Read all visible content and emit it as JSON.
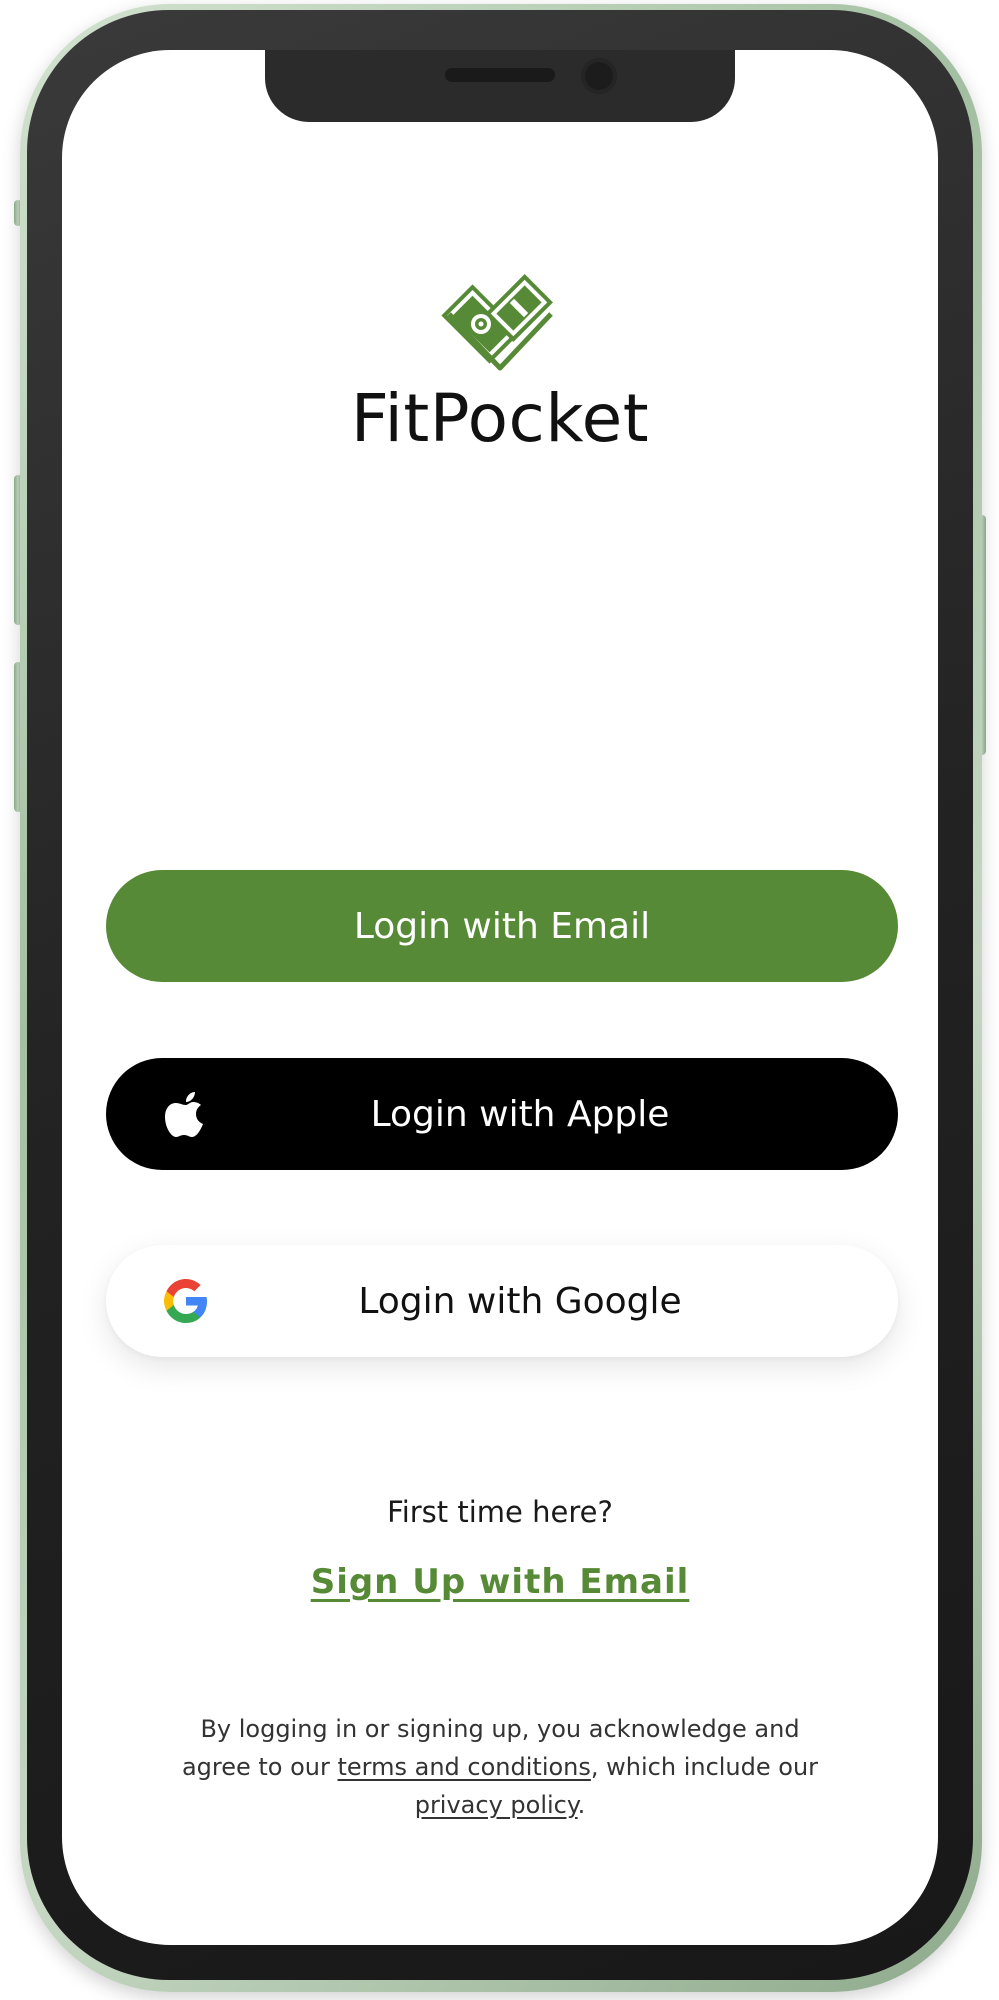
{
  "app": {
    "name": "FitPocket"
  },
  "buttons": {
    "email_login": "Login with Email",
    "apple_login": "Login with Apple",
    "google_login": "Login with Google"
  },
  "signup": {
    "prompt": "First time here?",
    "link": "Sign Up with Email"
  },
  "legal": {
    "part1": "By logging in or signing up, you acknowledge and agree to our ",
    "terms": "terms and conditions",
    "part2": ", which include our ",
    "privacy": "privacy policy",
    "part3": "."
  },
  "icons": {
    "logo": "money-heart-icon",
    "apple": "apple-icon",
    "google": "google-icon"
  },
  "colors": {
    "brand_green": "#568a36",
    "apple_black": "#000000",
    "frame_green": "#a3bfa1"
  }
}
